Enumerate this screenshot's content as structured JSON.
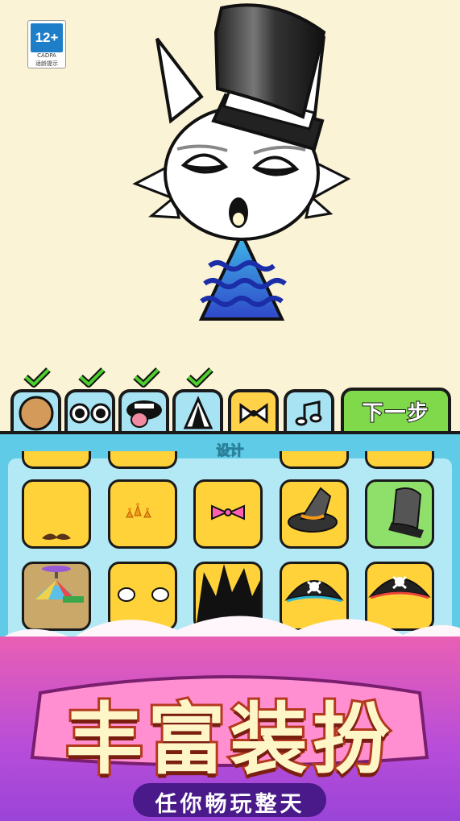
{
  "age_rating": {
    "label": "12+",
    "org": "CADPA",
    "hint": "适龄提示"
  },
  "tabs": [
    {
      "name": "body",
      "completed": true
    },
    {
      "name": "eyes",
      "completed": true
    },
    {
      "name": "mouth",
      "completed": true
    },
    {
      "name": "outfit",
      "completed": true
    },
    {
      "name": "accessory",
      "completed": false,
      "active": true
    },
    {
      "name": "music",
      "completed": false
    }
  ],
  "next_button": {
    "label": "下一步"
  },
  "panel": {
    "title": "设计"
  },
  "items": [
    {
      "name": "mustache"
    },
    {
      "name": "crown"
    },
    {
      "name": "bow-tie"
    },
    {
      "name": "witch-hat"
    },
    {
      "name": "top-hat",
      "selected": true
    },
    {
      "name": "propeller-cap"
    },
    {
      "name": "gloves"
    },
    {
      "name": "spiky-hair"
    },
    {
      "name": "pirate-hat"
    },
    {
      "name": "pirate-tricorn"
    }
  ],
  "banner": {
    "title": "丰富装扮",
    "subtitle": "任你畅玩整天"
  },
  "colors": {
    "background": "#faf3d6",
    "tab": "#a7e3f2",
    "active_tab": "#ffd24a",
    "next": "#7fd94a",
    "panel": "#5fcbe6",
    "item": "#ffd23a"
  }
}
